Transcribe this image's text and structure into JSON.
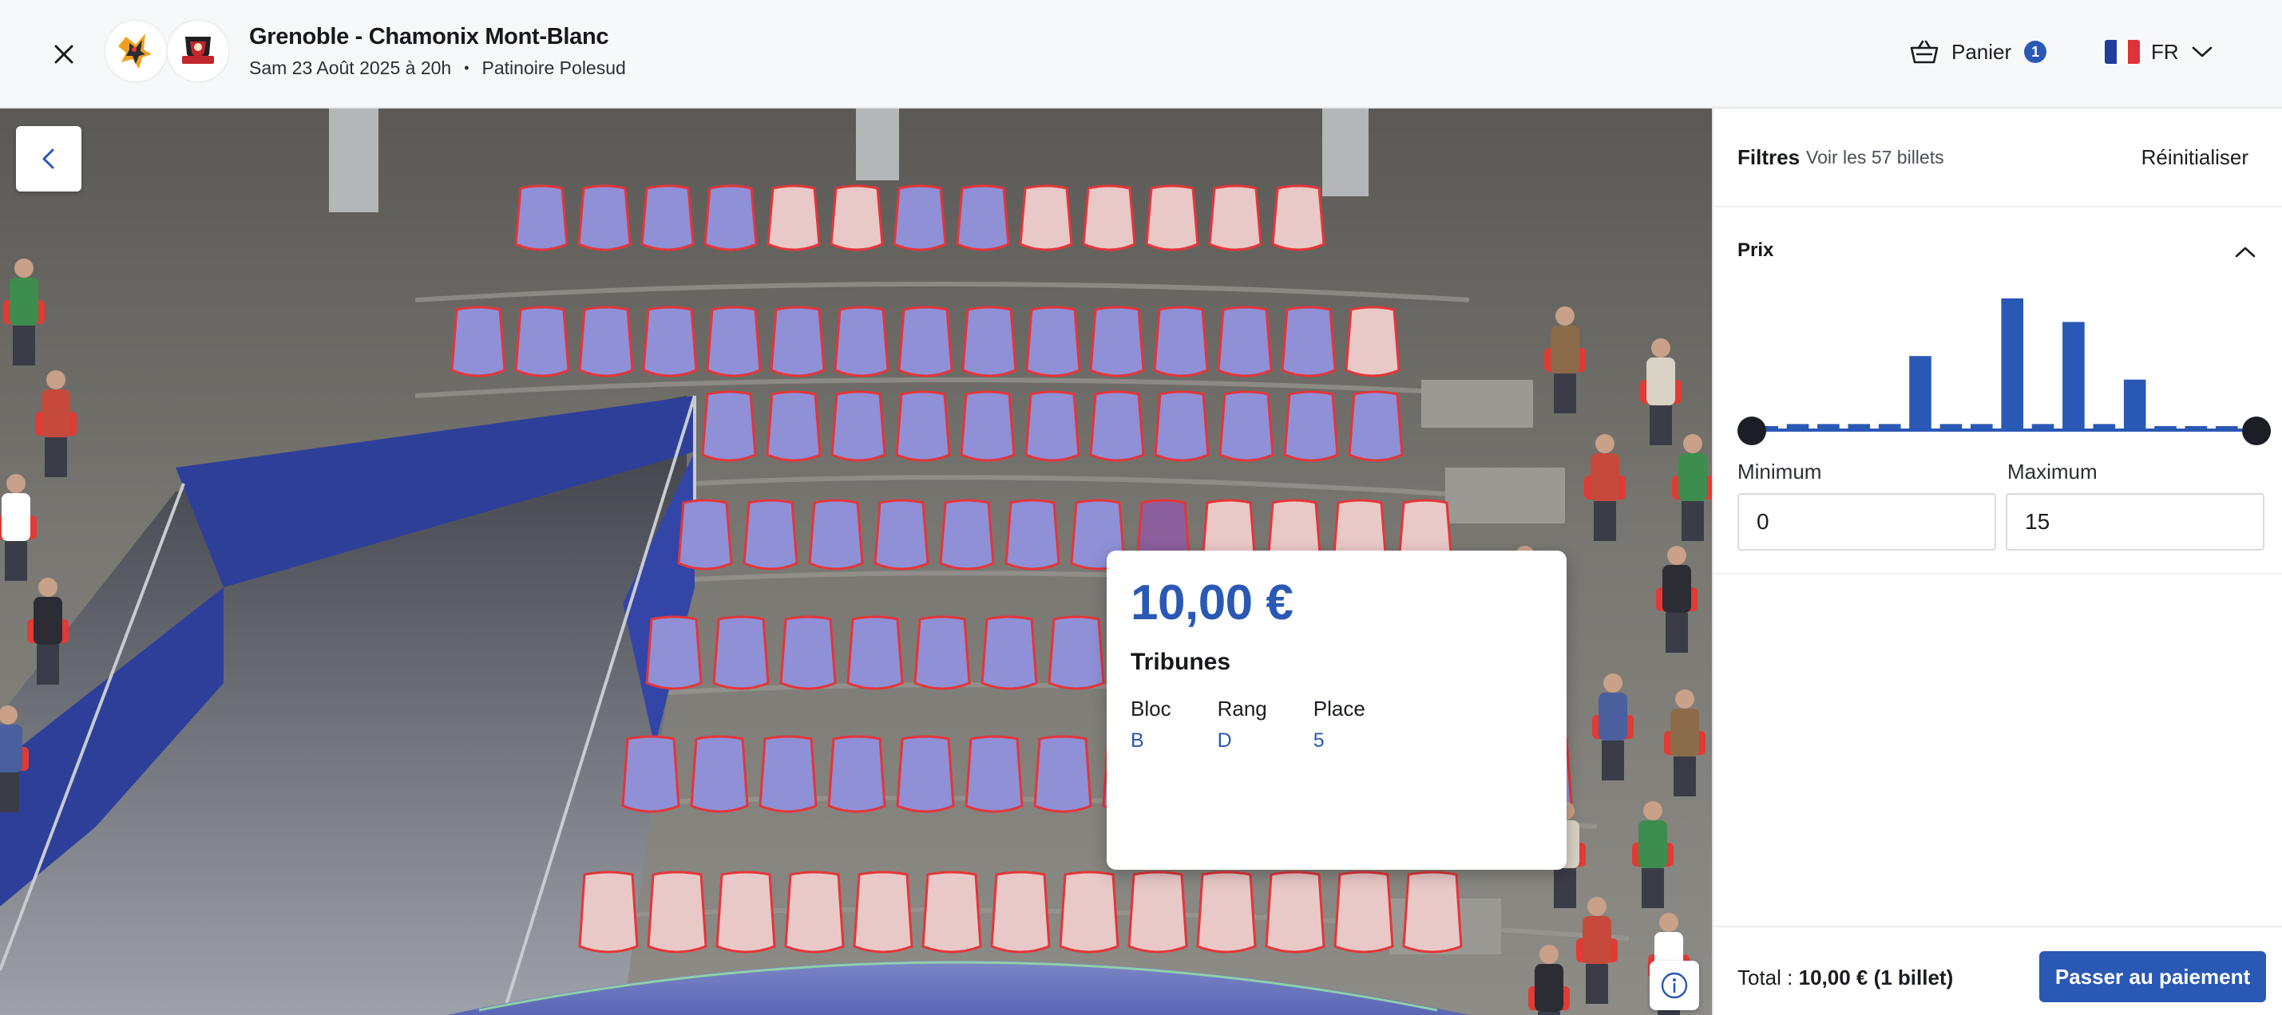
{
  "header": {
    "title": "Grenoble - Chamonix Mont-Blanc",
    "date": "Sam 23 Août 2025 à 20h",
    "separator": "•",
    "venue": "Patinoire Polesud",
    "cart_label": "Panier",
    "cart_count": "1",
    "language": "FR"
  },
  "tooltip": {
    "price": "10,00 €",
    "zone": "Tribunes",
    "bloc_label": "Bloc",
    "bloc_value": "B",
    "rang_label": "Rang",
    "rang_value": "D",
    "place_label": "Place",
    "place_value": "5"
  },
  "filters": {
    "title": "Filtres",
    "count_text": "Voir les 57 billets",
    "reset_label": "Réinitialiser",
    "price_section": "Prix",
    "price_histogram": [
      0.02,
      0.04,
      0.04,
      0.04,
      0.04,
      0.56,
      0.04,
      0.04,
      1.0,
      0.04,
      0.82,
      0.04,
      0.38,
      0.02,
      0.02,
      0.02
    ],
    "min_label": "Minimum",
    "min_value": "0",
    "max_label": "Maximum",
    "max_value": "15"
  },
  "footer": {
    "total_label": "Total :",
    "total_value": "10,00 € (1 billet)",
    "pay_label": "Passer au paiement"
  },
  "colors": {
    "accent": "#2a58b5",
    "seat_available": "#8f90d6",
    "seat_taken": "#e9c9c7",
    "seat_selected": "#8a5f9b",
    "seat_outline": "#e5353a",
    "balcony": "#2e3f9a"
  }
}
